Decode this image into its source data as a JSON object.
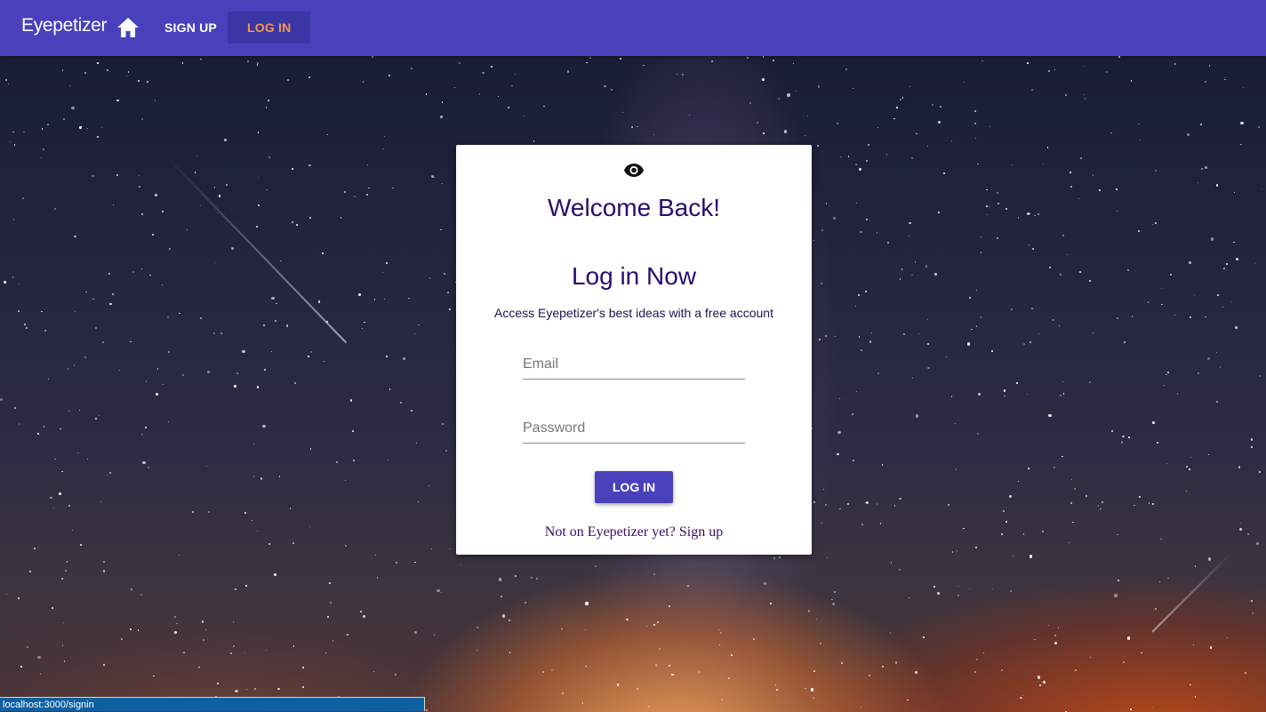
{
  "appbar": {
    "brand": "Eyepetizer",
    "home_icon": "home-icon",
    "nav": {
      "signup_label": "SIGN UP",
      "login_label": "LOG IN"
    },
    "colors": {
      "bar": "#4841bb",
      "active_text": "#f39a48"
    }
  },
  "login_card": {
    "icon": "eye-icon",
    "welcome": "Welcome Back!",
    "title": "Log in Now",
    "subtitle": "Access Eyepetizer's best ideas with a free account",
    "email_placeholder": "Email",
    "email_value": "",
    "password_placeholder": "Password",
    "password_value": "",
    "submit_label": "LOG IN",
    "signup_prompt": "Not on Eyepetizer yet?",
    "signup_link": "Sign up"
  },
  "statusbar": {
    "url": "localhost:3000/signin"
  }
}
